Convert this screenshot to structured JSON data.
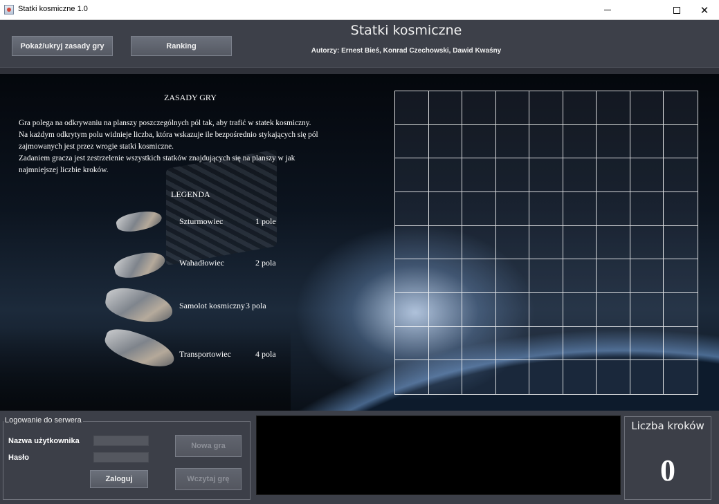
{
  "window": {
    "title": "Statki kosmiczne 1.0",
    "minimize": "–",
    "close": "✕"
  },
  "header": {
    "rules_button": "Pokaż/ukryj zasady gry",
    "ranking_button": "Ranking",
    "app_title": "Statki kosmiczne",
    "authors": "Autorzy: Ernest Bieś, Konrad Czechowski, Dawid Kwaśny"
  },
  "rules": {
    "title": "ZASADY GRY",
    "lines": [
      "Gra polega na odkrywaniu na planszy poszczególnych pól tak, aby trafić w statek kosmiczny.",
      "Na każdym odkrytym polu widnieje liczba, która wskazuje ile bezpośrednio stykających się pól",
      "zajmowanych jest przez wrogie statki kosmiczne.",
      "Zadaniem gracza jest zestrzelenie wszystkich statków znajdujących się na planszy w jak",
      "najmniejszej liczbie kroków."
    ],
    "legend_title": "LEGENDA",
    "legend": [
      {
        "name": "Szturmowiec",
        "size": "1 pole"
      },
      {
        "name": "Wahadłowiec",
        "size": "2 pola"
      },
      {
        "name": "Samolot kosmiczny",
        "size": "3 pola"
      },
      {
        "name": "Transportowiec",
        "size": "4 pola"
      }
    ]
  },
  "board": {
    "rows": 9,
    "cols": 9
  },
  "login": {
    "legend": "Logowanie do serwera",
    "username_label": "Nazwa użytkownika",
    "password_label": "Hasło",
    "login_button": "Zaloguj"
  },
  "game": {
    "new_game_button": "Nowa gra",
    "load_game_button": "Wczytaj grę"
  },
  "steps": {
    "label": "Liczba kroków",
    "value": "0"
  }
}
